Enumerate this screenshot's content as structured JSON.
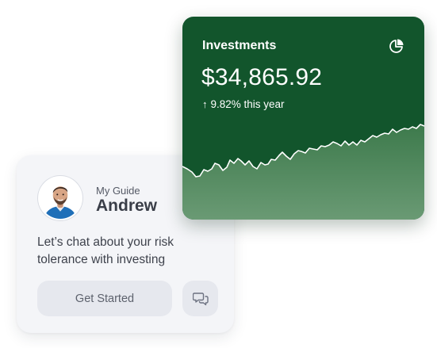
{
  "investments": {
    "title": "Investments",
    "amount": "$34,865.92",
    "change_arrow": "↑",
    "change_text": "9.82% this year",
    "icon": "pie-chart-icon",
    "colors": {
      "card_bg": "#12552c",
      "text": "#ffffff",
      "area_top": "#3d7a4c",
      "area_bottom": "#6a9a74"
    }
  },
  "guide": {
    "kicker": "My Guide",
    "name": "Andrew",
    "message": "Let’s chat about your risk tolerance with investing",
    "start_label": "Get Started",
    "chat_icon": "chat-bubbles-icon",
    "avatar": "avatar-photo"
  }
}
